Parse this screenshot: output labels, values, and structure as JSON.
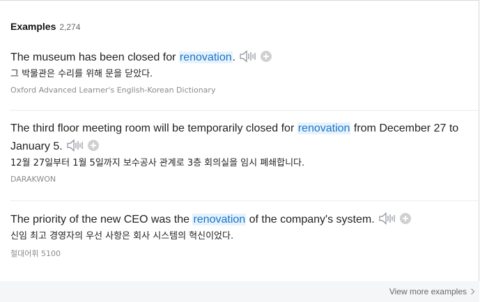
{
  "header": {
    "title": "Examples",
    "count": "2,274"
  },
  "examples": [
    {
      "before": "The museum has been closed for ",
      "keyword": "renovation",
      "after": ".",
      "translation": "그 박물관은 수리를 위해 문을 닫았다.",
      "source": "Oxford Advanced Learner's English-Korean Dictionary"
    },
    {
      "before": "The third floor meeting room will be temporarily closed for ",
      "keyword": "renovation",
      "after": " from December 27 to January 5.",
      "translation": "12월 27일부터 1월 5일까지 보수공사 관계로 3층 회의실을 임시 폐쇄합니다.",
      "source": "DARAKWON"
    },
    {
      "before": "The priority of the new CEO was the ",
      "keyword": "renovation",
      "after": " of the company's system.",
      "translation": "신임 최고 경영자의 우선 사항은 회사 시스템의 혁신이었다.",
      "source": "절대어휘 5100"
    }
  ],
  "footer": {
    "more_label": "View more examples"
  },
  "icons": {
    "sound": "speaker-sound-icon",
    "add": "plus-circle-icon",
    "more": "chevron-right-icon"
  },
  "colors": {
    "highlight_bg": "#e6f3fd",
    "highlight_text": "#1a73c8"
  }
}
